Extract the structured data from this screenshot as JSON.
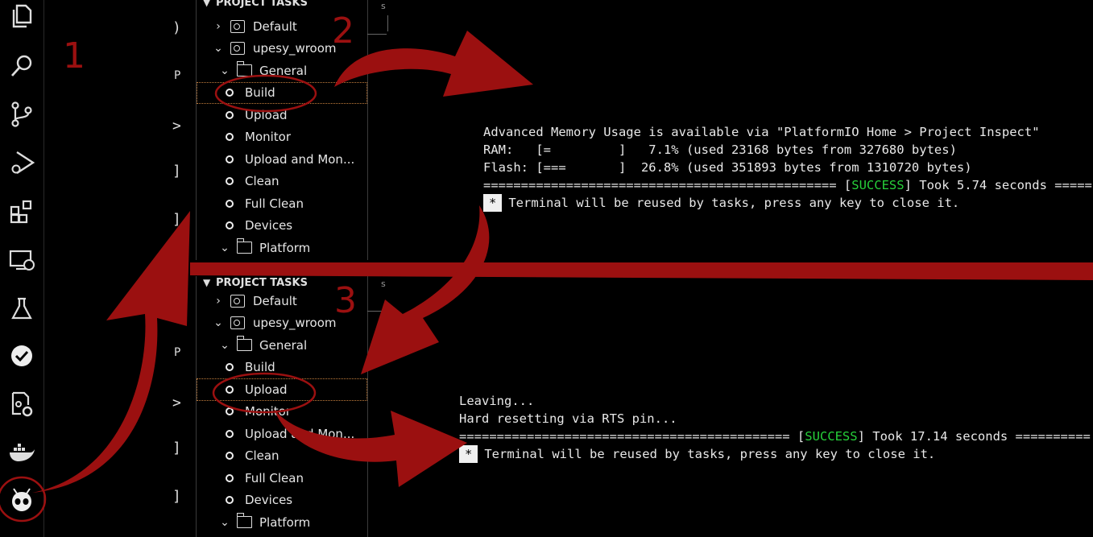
{
  "activity_bar": {
    "icons": [
      "explorer-icon",
      "search-icon",
      "source-control-icon",
      "run-debug-icon",
      "extensions-icon",
      "remote-explorer-icon",
      "testing-icon",
      "check-icon",
      "pio-settings-icon",
      "docker-icon",
      "platformio-alien-icon"
    ]
  },
  "annotations": {
    "step1": "1",
    "step2": "2",
    "step3": "3",
    "accent_color": "#9b1010"
  },
  "top": {
    "panel": {
      "title": "PROJECT TASKS",
      "rows": [
        {
          "label": "Default",
          "kind": "env",
          "indent": 1,
          "chev": "›"
        },
        {
          "label": "upesy_wroom",
          "kind": "env",
          "indent": 1,
          "chev": "⌄"
        },
        {
          "label": "General",
          "kind": "folder",
          "indent": 2,
          "chev": "⌄"
        },
        {
          "label": "Build",
          "kind": "task",
          "indent": 3,
          "selected": true
        },
        {
          "label": "Upload",
          "kind": "task",
          "indent": 3
        },
        {
          "label": "Monitor",
          "kind": "task",
          "indent": 3
        },
        {
          "label": "Upload and Mon...",
          "kind": "task",
          "indent": 3
        },
        {
          "label": "Clean",
          "kind": "task",
          "indent": 3
        },
        {
          "label": "Full Clean",
          "kind": "task",
          "indent": 3
        },
        {
          "label": "Devices",
          "kind": "task",
          "indent": 3
        },
        {
          "label": "Platform",
          "kind": "folder",
          "indent": 2,
          "chev": "⌄"
        }
      ]
    },
    "terminal": {
      "line1": "Advanced Memory Usage is available via \"PlatformIO Home > Project Inspect\"",
      "line2": "RAM:   [=         ]   7.1% (used 23168 bytes from 327680 bytes)",
      "line3": "Flash: [===       ]  26.8% (used 351893 bytes from 1310720 bytes)",
      "line4_prefix": "=============================================== [",
      "success": "SUCCESS",
      "line4_suffix": "] Took 5.74 seconds =====",
      "star": "*",
      "line5": "Terminal will be reused by tasks, press any key to close it."
    }
  },
  "bottom": {
    "panel": {
      "title": "PROJECT TASKS",
      "rows": [
        {
          "label": "Default",
          "kind": "env",
          "indent": 1,
          "chev": "›"
        },
        {
          "label": "upesy_wroom",
          "kind": "env",
          "indent": 1,
          "chev": "⌄"
        },
        {
          "label": "General",
          "kind": "folder",
          "indent": 2,
          "chev": "⌄"
        },
        {
          "label": "Build",
          "kind": "task",
          "indent": 3
        },
        {
          "label": "Upload",
          "kind": "task",
          "indent": 3,
          "selected": true
        },
        {
          "label": "Monitor",
          "kind": "task",
          "indent": 3
        },
        {
          "label": "Upload and Mon...",
          "kind": "task",
          "indent": 3
        },
        {
          "label": "Clean",
          "kind": "task",
          "indent": 3
        },
        {
          "label": "Full Clean",
          "kind": "task",
          "indent": 3
        },
        {
          "label": "Devices",
          "kind": "task",
          "indent": 3
        },
        {
          "label": "Platform",
          "kind": "folder",
          "indent": 2,
          "chev": "⌄"
        }
      ]
    },
    "terminal": {
      "line1": "Leaving...",
      "line2": "Hard resetting via RTS pin...",
      "line3_prefix": "============================================ [",
      "success": "SUCCESS",
      "line3_suffix": "] Took 17.14 seconds ==========",
      "star": "*",
      "line4": "Terminal will be reused by tasks, press any key to close it."
    }
  },
  "fragments": {
    "s": "s"
  }
}
